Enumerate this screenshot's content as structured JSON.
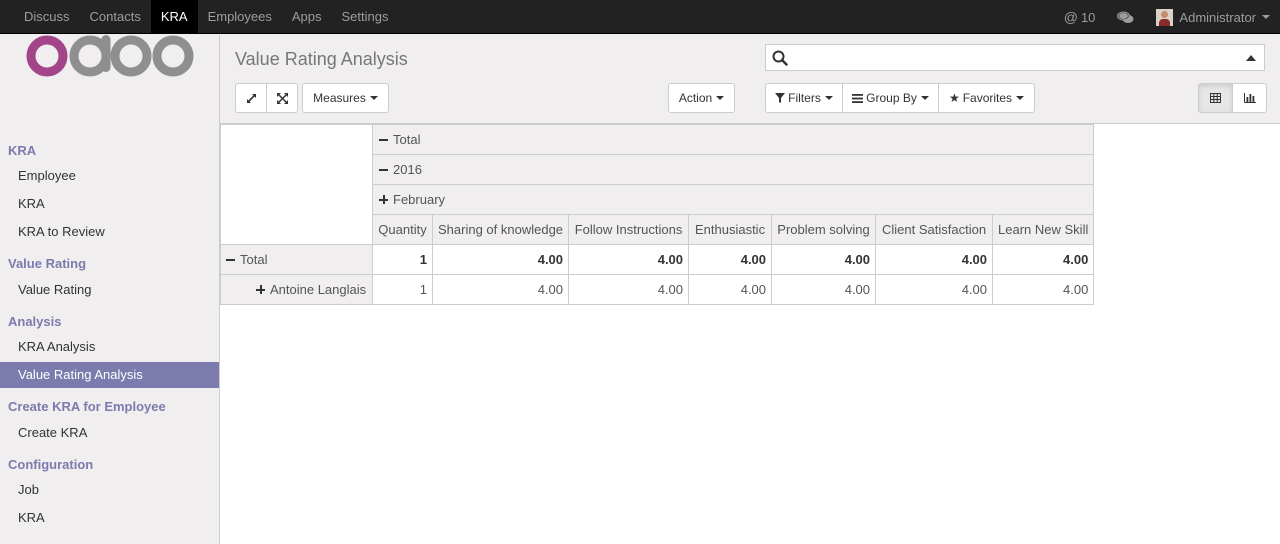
{
  "topbar": {
    "menu": [
      "Discuss",
      "Contacts",
      "KRA",
      "Employees",
      "Apps",
      "Settings"
    ],
    "active_index": 2,
    "mentions_count": "10",
    "user_name": "Administrator"
  },
  "brand": {
    "logo_text": "odoo",
    "colors": {
      "o1": "#a24689",
      "rest": "#8f8f8f"
    }
  },
  "sidebar": {
    "sections": [
      {
        "label": "KRA",
        "items": [
          "Employee",
          "KRA",
          "KRA to Review"
        ]
      },
      {
        "label": "Value Rating",
        "items": [
          "Value Rating"
        ]
      },
      {
        "label": "Analysis",
        "items": [
          "KRA Analysis",
          "Value Rating Analysis"
        ]
      },
      {
        "label": "Create KRA for Employee",
        "items": [
          "Create KRA"
        ]
      },
      {
        "label": "Configuration",
        "items": [
          "Job",
          "KRA"
        ]
      }
    ],
    "active_item": "Value Rating Analysis"
  },
  "control_panel": {
    "title": "Value Rating Analysis",
    "search": {
      "placeholder": ""
    },
    "buttons": {
      "expand_icon": "expand-arrows-icon",
      "fullscreen_icon": "fullscreen-icon",
      "measures": "Measures",
      "action": "Action",
      "filters": "Filters",
      "group_by": "Group By",
      "favorites": "Favorites"
    },
    "view_switcher": {
      "active": "pivot",
      "views": [
        "pivot-icon",
        "graph-icon"
      ]
    }
  },
  "pivot": {
    "col_headers": {
      "level1": "Total",
      "level2": "2016",
      "level3": "February"
    },
    "measures": [
      "Quantity",
      "Sharing of knowledge",
      "Follow Instructions",
      "Enthusiastic",
      "Problem solving",
      "Client Satisfaction",
      "Learn New Skill"
    ],
    "rows": [
      {
        "label": "Total",
        "expanded": true,
        "bold": true,
        "values": [
          "1",
          "4.00",
          "4.00",
          "4.00",
          "4.00",
          "4.00",
          "4.00"
        ]
      },
      {
        "label": "Antoine Langlais",
        "expanded": false,
        "bold": false,
        "values": [
          "1",
          "4.00",
          "4.00",
          "4.00",
          "4.00",
          "4.00",
          "4.00"
        ]
      }
    ]
  }
}
